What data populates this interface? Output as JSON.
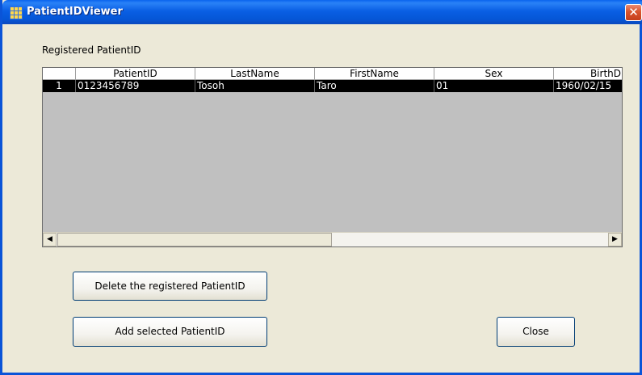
{
  "window": {
    "title": "PatientIDViewer",
    "close_glyph": "✕"
  },
  "group_label": "Registered PatientID",
  "grid": {
    "columns": [
      "PatientID",
      "LastName",
      "FirstName",
      "Sex",
      "BirthD"
    ],
    "rows": [
      {
        "row_number": "1",
        "patient_id": "0123456789",
        "last_name": "Tosoh",
        "first_name": "Taro",
        "sex": "01",
        "birth_date": "1960/02/15"
      }
    ],
    "scroll_left_glyph": "◀",
    "scroll_right_glyph": "▶"
  },
  "buttons": {
    "delete_label": "Delete the registered PatientID",
    "add_label": "Add selected PatientID",
    "close_label": "Close"
  },
  "colors": {
    "titlebar": "#0556d6",
    "selected_row_bg": "#000000",
    "grid_bg": "#c0c0c0",
    "dialog_bg": "#ece9d8"
  }
}
